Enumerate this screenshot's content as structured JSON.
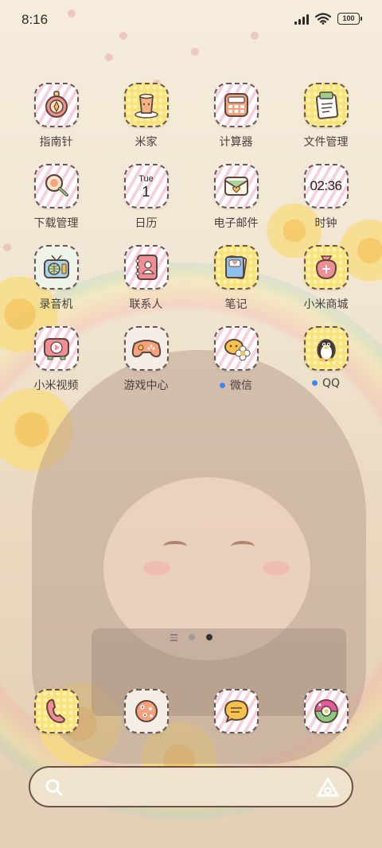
{
  "status_bar": {
    "time": "8:16",
    "battery": "100"
  },
  "apps": [
    {
      "label": "指南针",
      "icon": "compass-icon"
    },
    {
      "label": "米家",
      "icon": "mijia-cup-icon"
    },
    {
      "label": "计算器",
      "icon": "calculator-icon"
    },
    {
      "label": "文件管理",
      "icon": "clipboard-icon"
    },
    {
      "label": "下载管理",
      "icon": "magnifier-download-icon"
    },
    {
      "label": "日历",
      "icon": "calendar-icon",
      "day": "Tue",
      "date": "1"
    },
    {
      "label": "电子邮件",
      "icon": "envelope-icon"
    },
    {
      "label": "时钟",
      "icon": "clock-icon",
      "clock_text": "02:36"
    },
    {
      "label": "录音机",
      "icon": "radio-icon"
    },
    {
      "label": "联系人",
      "icon": "contacts-book-icon"
    },
    {
      "label": "笔记",
      "icon": "notes-icon"
    },
    {
      "label": "小米商城",
      "icon": "shopping-bag-icon"
    },
    {
      "label": "小米视频",
      "icon": "tv-play-icon"
    },
    {
      "label": "游戏中心",
      "icon": "gamepad-icon"
    },
    {
      "label": "微信",
      "icon": "wechat-icon",
      "new": true
    },
    {
      "label": "QQ",
      "icon": "qq-penguin-icon",
      "new": true
    }
  ],
  "dock": [
    {
      "icon": "phone-icon"
    },
    {
      "icon": "cookie-icon"
    },
    {
      "icon": "message-bubble-icon"
    },
    {
      "icon": "camera-icon"
    }
  ],
  "page_indicator": {
    "pages": 2,
    "active": 2
  },
  "search": {
    "placeholder": ""
  },
  "colors": {
    "accent_dot": "#3e86f0",
    "outline": "#6a5650"
  }
}
